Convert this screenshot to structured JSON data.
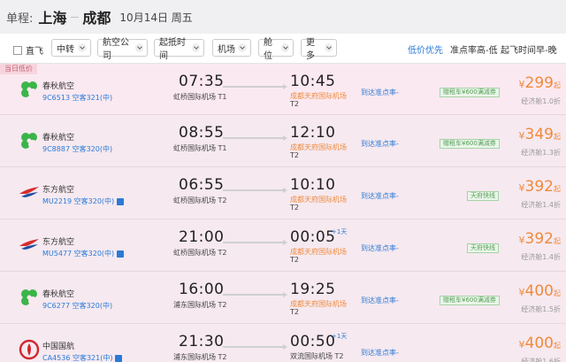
{
  "header": {
    "kind": "单程:",
    "from": "上海",
    "sep": "—",
    "to": "成都",
    "date": "10月14日 周五"
  },
  "filters": {
    "direct": "直飞",
    "dropdowns": [
      "中转",
      "航空公司",
      "起抵时间",
      "机场",
      "舱位",
      "更多"
    ],
    "sorts": [
      "低价优先",
      "准点率高-低",
      "起飞时间早-晚"
    ]
  },
  "badge": "当日低价",
  "flights": [
    {
      "airline": "春秋航空",
      "logo": "spring-logo",
      "flight": "9C6513 空客321(中)",
      "share": false,
      "dep": "07:35",
      "dep_ap": "虹桥国际机场 T1",
      "arr": "10:45",
      "arr_ap": "成都天府国际机场",
      "arr_term": "T2",
      "plus": "",
      "punct": "到达准点率-",
      "promo": "赠租车¥600满减券",
      "cur": "¥",
      "price": "299",
      "up": "起",
      "disc": "经济舱1.0折"
    },
    {
      "airline": "春秋航空",
      "logo": "spring-logo",
      "flight": "9C8887 空客320(中)",
      "share": false,
      "dep": "08:55",
      "dep_ap": "虹桥国际机场 T1",
      "arr": "12:10",
      "arr_ap": "成都天府国际机场",
      "arr_term": "T2",
      "plus": "",
      "punct": "到达准点率-",
      "promo": "赠租车¥600满减券",
      "cur": "¥",
      "price": "349",
      "up": "起",
      "disc": "经济舱1.3折"
    },
    {
      "airline": "东方航空",
      "logo": "china-eastern-logo",
      "flight": "MU2219 空客320(中)",
      "share": true,
      "dep": "06:55",
      "dep_ap": "虹桥国际机场 T2",
      "arr": "10:10",
      "arr_ap": "成都天府国际机场",
      "arr_term": "T2",
      "plus": "",
      "punct": "到达准点率-",
      "promo": "天府快线",
      "cur": "¥",
      "price": "392",
      "up": "起",
      "disc": "经济舱1.4折"
    },
    {
      "airline": "东方航空",
      "logo": "china-eastern-logo",
      "flight": "MU5477 空客320(中)",
      "share": true,
      "dep": "21:00",
      "dep_ap": "虹桥国际机场 T2",
      "arr": "00:05",
      "arr_ap": "成都天府国际机场",
      "arr_term": "T2",
      "plus": "+1天",
      "punct": "到达准点率-",
      "promo": "天府快线",
      "cur": "¥",
      "price": "392",
      "up": "起",
      "disc": "经济舱1.4折"
    },
    {
      "airline": "春秋航空",
      "logo": "spring-logo",
      "flight": "9C6277 空客320(中)",
      "share": false,
      "dep": "16:00",
      "dep_ap": "浦东国际机场 T2",
      "arr": "19:25",
      "arr_ap": "成都天府国际机场",
      "arr_term": "T2",
      "plus": "",
      "punct": "到达准点率-",
      "promo": "赠租车¥600满减券",
      "cur": "¥",
      "price": "400",
      "up": "起",
      "disc": "经济舱1.5折"
    },
    {
      "airline": "中国国航",
      "logo": "air-china-logo",
      "flight": "CA4536 空客321(中)",
      "share": true,
      "dep": "21:30",
      "dep_ap": "浦东国际机场 T2",
      "arr": "00:50",
      "arr_ap": "双流国际机场 T2",
      "arr_term": "",
      "plus": "+1天",
      "punct": "到达准点率-",
      "promo": "",
      "cur": "¥",
      "price": "400",
      "up": "起",
      "disc": "经济舱1.6折"
    }
  ]
}
